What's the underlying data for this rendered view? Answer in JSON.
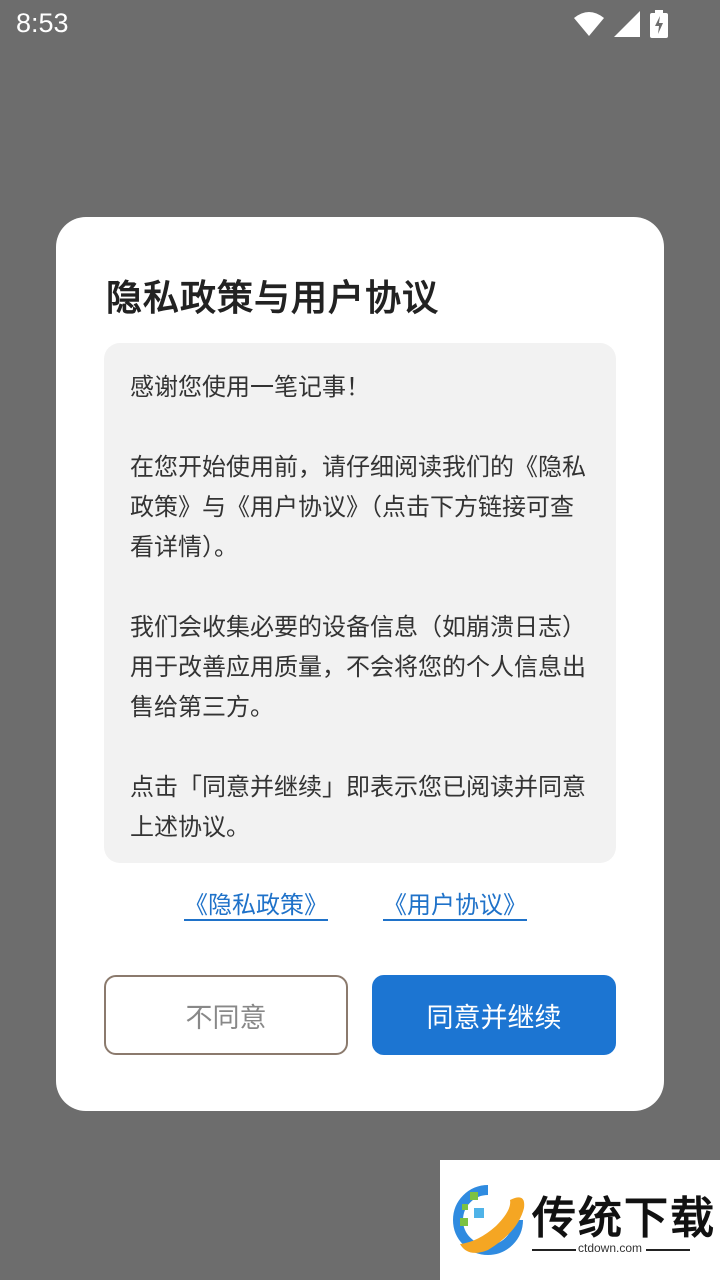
{
  "status_bar": {
    "time": "8:53"
  },
  "dialog": {
    "title": "隐私政策与用户协议",
    "paragraphs": [
      "感谢您使用一笔记事！",
      "在您开始使用前，请仔细阅读我们的《隐私政策》与《用户协议》（点击下方链接可查看详情）。",
      "我们会收集必要的设备信息（如崩溃日志）用于改善应用质量，不会将您的个人信息出售给第三方。",
      "点击「同意并继续」即表示您已阅读并同意上述协议。"
    ],
    "links": {
      "privacy": "《隐私政策》",
      "user_agreement": "《用户协议》"
    },
    "buttons": {
      "disagree": "不同意",
      "agree": "同意并继续"
    }
  },
  "watermark": {
    "name": "传统下载",
    "domain": "ctdown.com"
  },
  "colors": {
    "overlay": "#6d6d6d",
    "primary": "#1c75d2",
    "link": "#1f72c9",
    "content_bg": "#f2f2f2"
  }
}
